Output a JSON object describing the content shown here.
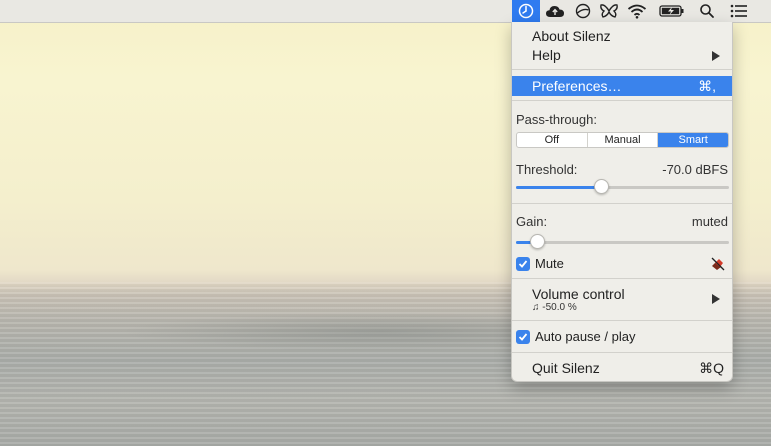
{
  "menubar": {
    "icons": [
      "silenz-icon",
      "cloud-upload-icon",
      "circle-slash-icon",
      "butterfly-icon",
      "wifi-icon",
      "battery-charging-icon",
      "search-icon",
      "list-icon"
    ]
  },
  "menu": {
    "about": "About Silenz",
    "help": "Help",
    "preferences": "Preferences…",
    "preferences_shortcut": "⌘,",
    "passthrough_label": "Pass-through:",
    "passthrough_options": [
      "Off",
      "Manual",
      "Smart"
    ],
    "passthrough_selected": "Smart",
    "threshold_label": "Threshold:",
    "threshold_value": "-70.0 dBFS",
    "threshold_level": 0.4,
    "gain_label": "Gain:",
    "gain_value": "muted",
    "gain_level": 0.1,
    "mute_label": "Mute",
    "mute_checked": true,
    "volume_label": "Volume control",
    "volume_value": "-50.0 %",
    "autopause_label": "Auto pause / play",
    "autopause_checked": true,
    "quit": "Quit Silenz",
    "quit_shortcut": "⌘Q"
  },
  "colors": {
    "accent": "#3a83ec",
    "menubar": "#e9e8e3",
    "menu_bg": "#efeee9"
  }
}
